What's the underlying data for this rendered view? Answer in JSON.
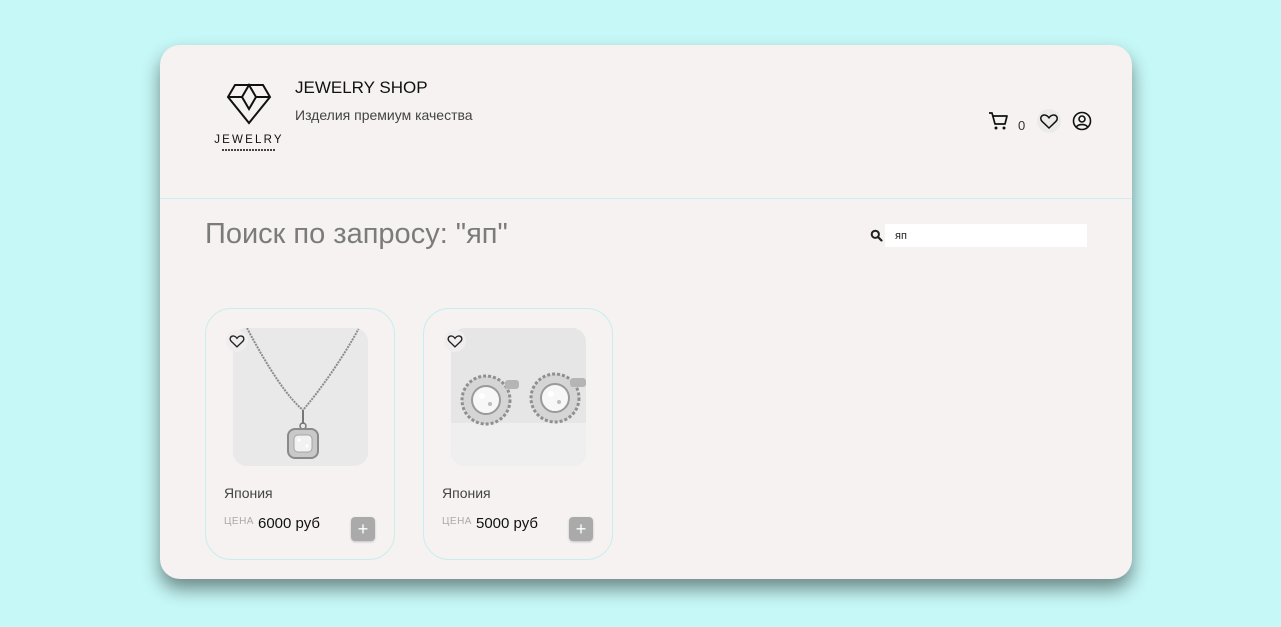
{
  "header": {
    "logo_text": "JEWELRY",
    "title": "JEWELRY SHOP",
    "subtitle": "Изделия премиум качества",
    "cart_count": "0"
  },
  "search": {
    "heading": "Поиск по запросу: \"яп\"",
    "value": "яп",
    "placeholder": ""
  },
  "products": [
    {
      "name": "Япония",
      "price_label": "ЦЕНА",
      "price": "6000 руб",
      "image": "pendant-necklace",
      "add_label": "+"
    },
    {
      "name": "Япония",
      "price_label": "ЦЕНА",
      "price": "5000 руб",
      "image": "diamond-stud-earrings",
      "add_label": "+"
    }
  ],
  "colors": {
    "background": "#c6f8f7",
    "panel": "#f5f2f1",
    "card_border": "#c7eeee",
    "add_button": "#aaaaaa"
  }
}
